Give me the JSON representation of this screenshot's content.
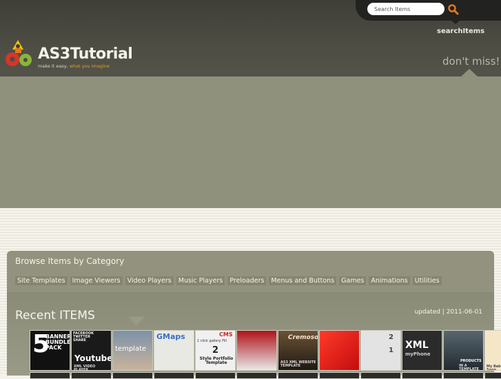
{
  "search": {
    "placeholder": "Search Items",
    "label": "searchItems"
  },
  "logo": {
    "title_prefix": "AS3",
    "title_rest": "Tutorial",
    "tagline_main": "make it easy,",
    "tagline_accent": "what you imagine"
  },
  "dont_miss": "don't miss!",
  "browse": {
    "title": "Browse Items by Category",
    "categories": [
      "Site Templates",
      "Image Viewers",
      "Video Players",
      "Music Players",
      "Preloaders",
      "Menus and Buttons",
      "Games",
      "Animations",
      "Utilities"
    ]
  },
  "recent": {
    "title": "Recent ITEMS",
    "updated": "updated | 2011-06-01",
    "thumbs": [
      {
        "line1": "5",
        "line2": "BANNER BUNDLE PACK"
      },
      {
        "line1": "FACEBOOK TWITTER SHARE",
        "line2": "Youtube",
        "line3": "XML VIDEO PLAYER"
      },
      {
        "line1": "template"
      },
      {
        "line1": "GMaps"
      },
      {
        "line1": "1 click gallery Fill",
        "line2": "2",
        "line3": "Style Portfolio Template",
        "badge": "CMS"
      },
      {
        "line1": ""
      },
      {
        "line1": "Cremoso",
        "line2": "AS3 XML WEBSITE TEMPLATE"
      },
      {
        "line1": ""
      },
      {
        "line1": "2",
        "line2": "1"
      },
      {
        "line1": "XML",
        "line2": "myPhone"
      },
      {
        "line1": "PRODUCTS",
        "line2": "IN A TEMPLATE"
      },
      {
        "line1": "My Baby Coming Soon"
      }
    ]
  },
  "colors": {
    "header": "#4d4d44",
    "banner": "#8f917d",
    "panel": "#92927f",
    "accent": "#e5a11c"
  }
}
